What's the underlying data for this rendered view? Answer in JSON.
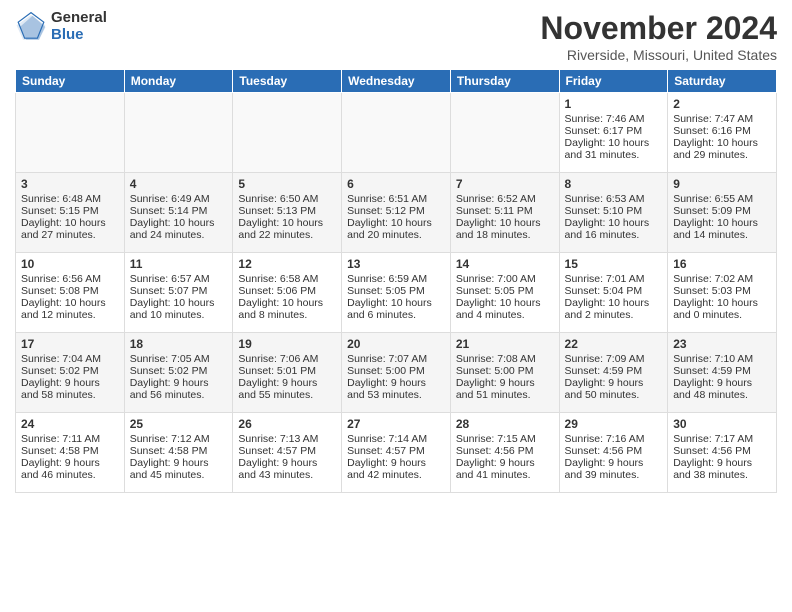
{
  "header": {
    "logo_general": "General",
    "logo_blue": "Blue",
    "month_title": "November 2024",
    "location": "Riverside, Missouri, United States"
  },
  "days_of_week": [
    "Sunday",
    "Monday",
    "Tuesday",
    "Wednesday",
    "Thursday",
    "Friday",
    "Saturday"
  ],
  "weeks": [
    [
      {
        "day": "",
        "info": ""
      },
      {
        "day": "",
        "info": ""
      },
      {
        "day": "",
        "info": ""
      },
      {
        "day": "",
        "info": ""
      },
      {
        "day": "",
        "info": ""
      },
      {
        "day": "1",
        "info": "Sunrise: 7:46 AM\nSunset: 6:17 PM\nDaylight: 10 hours and 31 minutes."
      },
      {
        "day": "2",
        "info": "Sunrise: 7:47 AM\nSunset: 6:16 PM\nDaylight: 10 hours and 29 minutes."
      }
    ],
    [
      {
        "day": "3",
        "info": "Sunrise: 6:48 AM\nSunset: 5:15 PM\nDaylight: 10 hours and 27 minutes."
      },
      {
        "day": "4",
        "info": "Sunrise: 6:49 AM\nSunset: 5:14 PM\nDaylight: 10 hours and 24 minutes."
      },
      {
        "day": "5",
        "info": "Sunrise: 6:50 AM\nSunset: 5:13 PM\nDaylight: 10 hours and 22 minutes."
      },
      {
        "day": "6",
        "info": "Sunrise: 6:51 AM\nSunset: 5:12 PM\nDaylight: 10 hours and 20 minutes."
      },
      {
        "day": "7",
        "info": "Sunrise: 6:52 AM\nSunset: 5:11 PM\nDaylight: 10 hours and 18 minutes."
      },
      {
        "day": "8",
        "info": "Sunrise: 6:53 AM\nSunset: 5:10 PM\nDaylight: 10 hours and 16 minutes."
      },
      {
        "day": "9",
        "info": "Sunrise: 6:55 AM\nSunset: 5:09 PM\nDaylight: 10 hours and 14 minutes."
      }
    ],
    [
      {
        "day": "10",
        "info": "Sunrise: 6:56 AM\nSunset: 5:08 PM\nDaylight: 10 hours and 12 minutes."
      },
      {
        "day": "11",
        "info": "Sunrise: 6:57 AM\nSunset: 5:07 PM\nDaylight: 10 hours and 10 minutes."
      },
      {
        "day": "12",
        "info": "Sunrise: 6:58 AM\nSunset: 5:06 PM\nDaylight: 10 hours and 8 minutes."
      },
      {
        "day": "13",
        "info": "Sunrise: 6:59 AM\nSunset: 5:05 PM\nDaylight: 10 hours and 6 minutes."
      },
      {
        "day": "14",
        "info": "Sunrise: 7:00 AM\nSunset: 5:05 PM\nDaylight: 10 hours and 4 minutes."
      },
      {
        "day": "15",
        "info": "Sunrise: 7:01 AM\nSunset: 5:04 PM\nDaylight: 10 hours and 2 minutes."
      },
      {
        "day": "16",
        "info": "Sunrise: 7:02 AM\nSunset: 5:03 PM\nDaylight: 10 hours and 0 minutes."
      }
    ],
    [
      {
        "day": "17",
        "info": "Sunrise: 7:04 AM\nSunset: 5:02 PM\nDaylight: 9 hours and 58 minutes."
      },
      {
        "day": "18",
        "info": "Sunrise: 7:05 AM\nSunset: 5:02 PM\nDaylight: 9 hours and 56 minutes."
      },
      {
        "day": "19",
        "info": "Sunrise: 7:06 AM\nSunset: 5:01 PM\nDaylight: 9 hours and 55 minutes."
      },
      {
        "day": "20",
        "info": "Sunrise: 7:07 AM\nSunset: 5:00 PM\nDaylight: 9 hours and 53 minutes."
      },
      {
        "day": "21",
        "info": "Sunrise: 7:08 AM\nSunset: 5:00 PM\nDaylight: 9 hours and 51 minutes."
      },
      {
        "day": "22",
        "info": "Sunrise: 7:09 AM\nSunset: 4:59 PM\nDaylight: 9 hours and 50 minutes."
      },
      {
        "day": "23",
        "info": "Sunrise: 7:10 AM\nSunset: 4:59 PM\nDaylight: 9 hours and 48 minutes."
      }
    ],
    [
      {
        "day": "24",
        "info": "Sunrise: 7:11 AM\nSunset: 4:58 PM\nDaylight: 9 hours and 46 minutes."
      },
      {
        "day": "25",
        "info": "Sunrise: 7:12 AM\nSunset: 4:58 PM\nDaylight: 9 hours and 45 minutes."
      },
      {
        "day": "26",
        "info": "Sunrise: 7:13 AM\nSunset: 4:57 PM\nDaylight: 9 hours and 43 minutes."
      },
      {
        "day": "27",
        "info": "Sunrise: 7:14 AM\nSunset: 4:57 PM\nDaylight: 9 hours and 42 minutes."
      },
      {
        "day": "28",
        "info": "Sunrise: 7:15 AM\nSunset: 4:56 PM\nDaylight: 9 hours and 41 minutes."
      },
      {
        "day": "29",
        "info": "Sunrise: 7:16 AM\nSunset: 4:56 PM\nDaylight: 9 hours and 39 minutes."
      },
      {
        "day": "30",
        "info": "Sunrise: 7:17 AM\nSunset: 4:56 PM\nDaylight: 9 hours and 38 minutes."
      }
    ]
  ]
}
